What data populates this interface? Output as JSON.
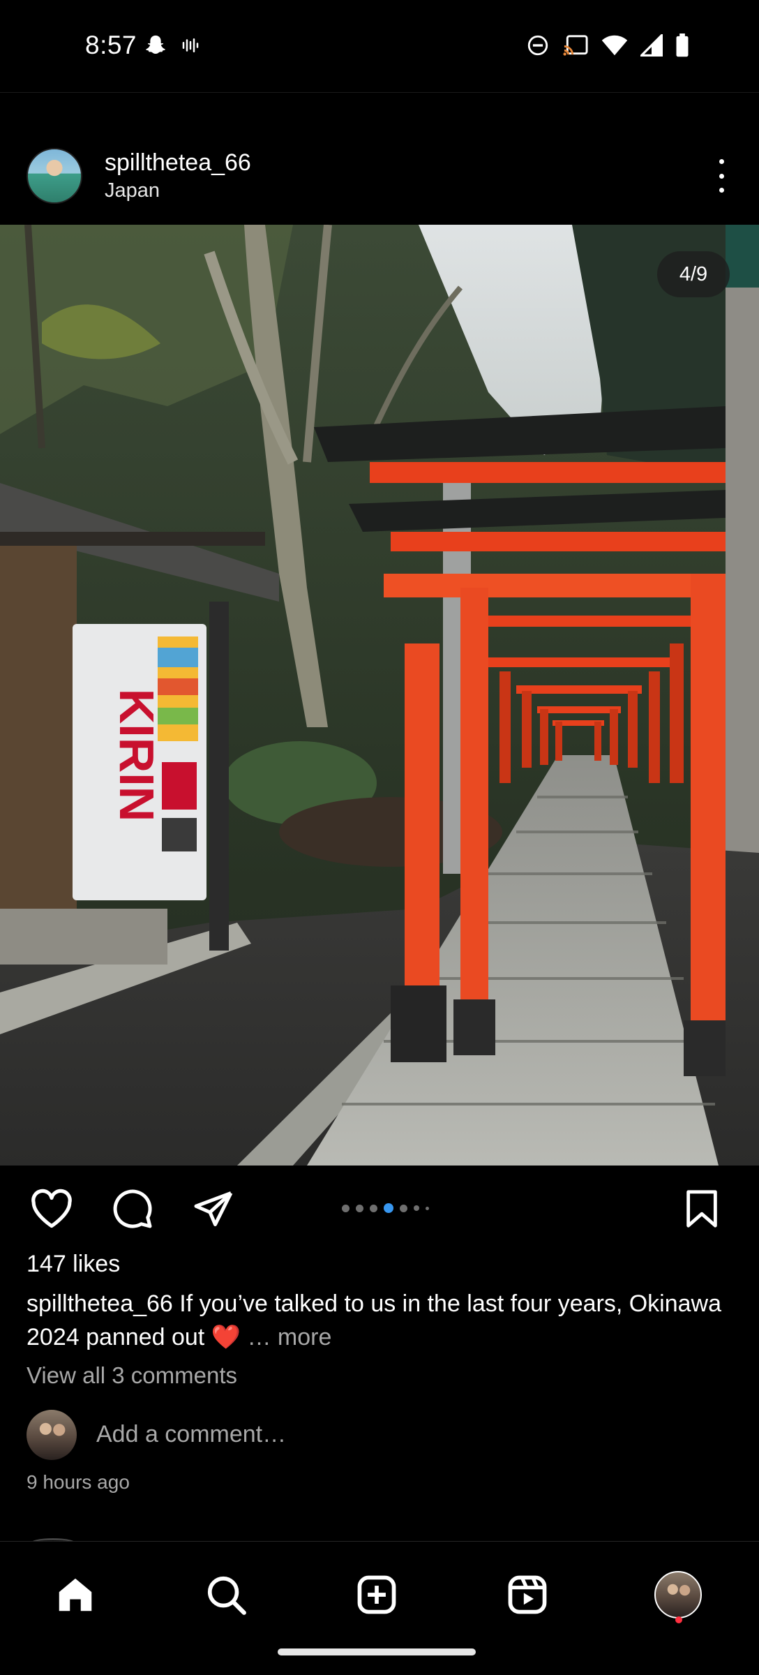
{
  "status_bar": {
    "time": "8:57",
    "left_icons": [
      "snapchat-icon",
      "voicemail-icon"
    ],
    "right_icons": [
      "do-not-disturb-icon",
      "cast-icon",
      "wifi-icon",
      "signal-icon",
      "battery-icon"
    ]
  },
  "post": {
    "username": "spillthetea_66",
    "location": "Japan",
    "image_counter": "4/9",
    "carousel": {
      "total_dots": 7,
      "active_index": 3
    },
    "likes": "147 likes",
    "caption": {
      "username": "spillthetea_66",
      "text": "If you’ve talked to us in the last four years, Okinawa 2024 panned out ❤️",
      "more": "… more"
    },
    "view_comments": "View all 3 comments",
    "add_comment_placeholder": "Add a comment…",
    "timestamp": "9 hours ago",
    "image_text": {
      "vending_brand": "KIRIN"
    }
  },
  "bottom_nav": {
    "items": [
      "home-icon",
      "search-icon",
      "create-icon",
      "reels-icon",
      "profile-avatar"
    ]
  },
  "colors": {
    "background": "#000000",
    "accent_blue": "#3897f0",
    "muted_text": "#a8a8a8",
    "notification_red": "#ff3040",
    "torii_vermilion": "#e8401c"
  }
}
